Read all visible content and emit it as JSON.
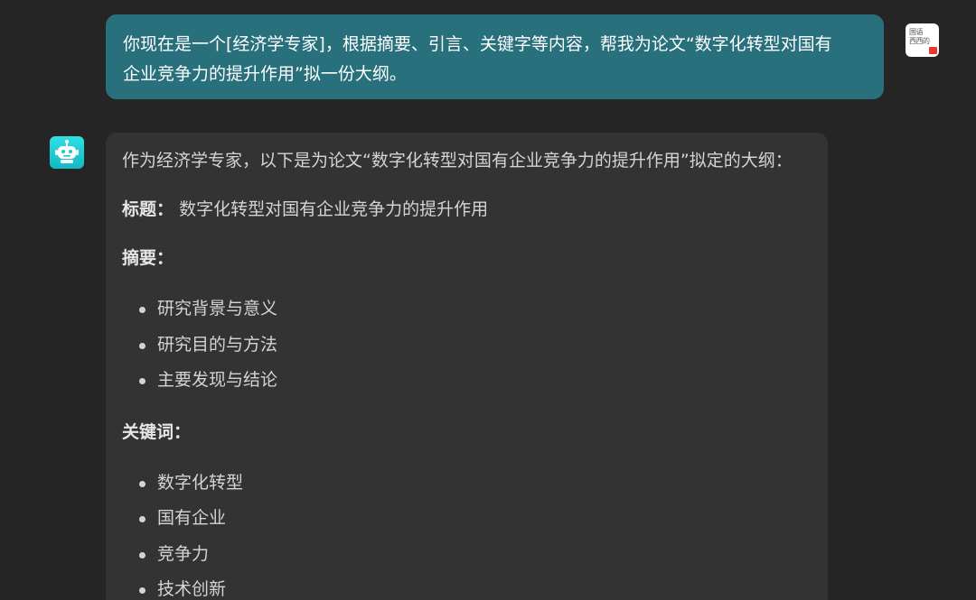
{
  "user_message": {
    "line1": "你现在是一个[经济学专家]，根据摘要、引言、关键字等内容，帮我为论文“数字化转型对国有",
    "line2": "企业竞争力的提升作用”拟一份大纲。"
  },
  "user_avatar": {
    "icon": "brand-logo-icon",
    "text_line1": "国语",
    "text_line2": "西西的",
    "accent_color": "#e8392e"
  },
  "bot_avatar": {
    "icon": "robot-icon",
    "color": "#20cfd6"
  },
  "bot_message": {
    "intro": "作为经济学专家，以下是为论文“数字化转型对国有企业竞争力的提升作用”拟定的大纲：",
    "title_label": "标题：",
    "title_value": "数字化转型对国有企业竞争力的提升作用",
    "abstract_label": "摘要：",
    "abstract_items": [
      "研究背景与意义",
      "研究目的与方法",
      "主要发现与结论"
    ],
    "keywords_label": "关键词：",
    "keyword_items": [
      "数字化转型",
      "国有企业",
      "竞争力",
      "技术创新"
    ]
  },
  "colors": {
    "background": "#252525",
    "user_bubble": "#27707c",
    "bot_bubble": "#333333",
    "text_light": "#d4d4d4"
  }
}
